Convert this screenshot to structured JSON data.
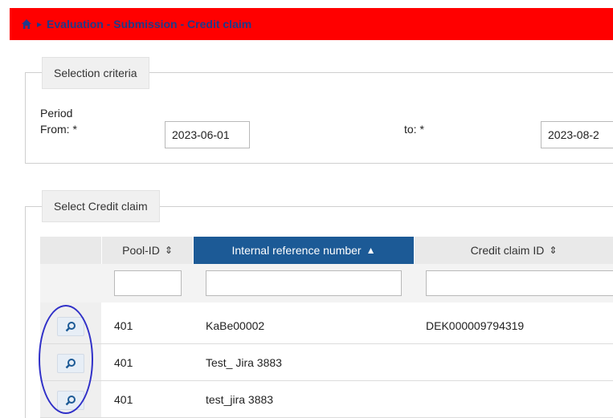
{
  "breadcrumb": {
    "separator": "▸",
    "title": "Evaluation - Submission - Credit claim"
  },
  "selection": {
    "legend": "Selection criteria",
    "period_label": "Period",
    "from_label": "From: *",
    "from_value": "2023-06-01",
    "to_label": "to: *",
    "to_value": "2023-08-2"
  },
  "credit_claim": {
    "legend": "Select Credit claim",
    "columns": [
      {
        "label": "Pool-ID",
        "sort": "⇕"
      },
      {
        "label": "Internal reference number",
        "sort": "▲"
      },
      {
        "label": "Credit claim ID",
        "sort": "⇕"
      }
    ],
    "rows": [
      {
        "pool_id": "401",
        "internal_ref": "KaBe00002",
        "claim_id": "DEK000009794319"
      },
      {
        "pool_id": "401",
        "internal_ref": "Test_ Jira 3883",
        "claim_id": ""
      },
      {
        "pool_id": "401",
        "internal_ref": "test_jira 3883",
        "claim_id": ""
      }
    ]
  },
  "colors": {
    "topbar": "#ff0000",
    "active_header": "#1c5a96",
    "annotation": "#3030c8"
  },
  "icons": [
    "home-icon",
    "search-icon"
  ]
}
